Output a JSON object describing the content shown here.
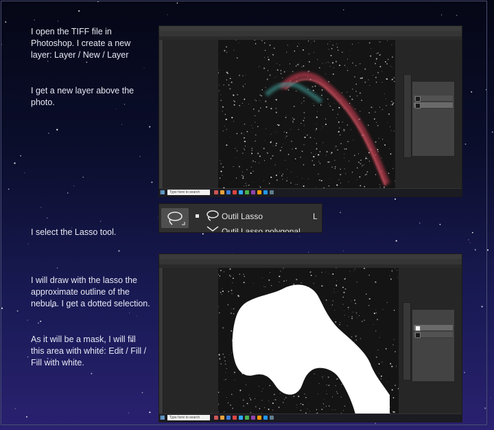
{
  "paragraphs": {
    "p1": "I open the TIFF file in Photoshop. I create a new layer: Layer / New / Layer",
    "p2": "I get a new layer above the photo.",
    "p3": "I select the Lasso tool.",
    "p4": "I will draw with the lasso the approximate outline of the nebula. I get a dotted selection.",
    "p5": "As it will be a mask, I will fill this area with white: Edit / Fill / Fill with white."
  },
  "lasso_menu": {
    "tool_label": "Outil Lasso",
    "shortcut": "L",
    "next_item": "Outil Lasso polygonal",
    "icon": "lasso-icon"
  },
  "taskbar": {
    "search_placeholder": "Type here to search"
  },
  "colors": {
    "nebula_red": "#b0394a",
    "nebula_teal": "#3f9c98",
    "mask_white": "#ffffff",
    "ps_panel": "#434343"
  }
}
